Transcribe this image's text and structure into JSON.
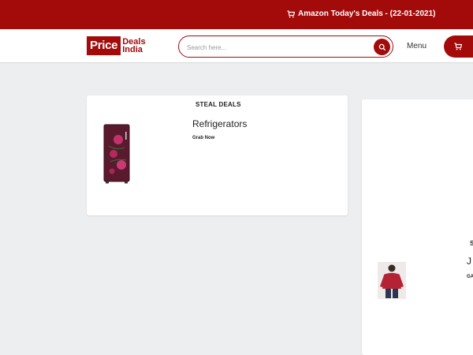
{
  "topbar": {
    "deal_text": "Amazon Today's Deals - (22-01-2021)",
    "icon": "shopping-cart-icon",
    "background": "#a30b0b"
  },
  "header": {
    "logo": {
      "price": "Price",
      "deals": "Deals",
      "india": "India"
    },
    "search": {
      "placeholder": "Search here...",
      "icon": "search-icon"
    },
    "menu_label": "Menu",
    "cart_icon": "shopping-cart-icon",
    "accent": "#a30b0b"
  },
  "cards": [
    {
      "badge": "STEAL DEALS",
      "title": "Refrigerators",
      "cta": "Grab Now",
      "image": "refrigerator-image"
    },
    {
      "badge": "S",
      "title": "J",
      "cta": "GA",
      "image": "jacket-image"
    }
  ]
}
